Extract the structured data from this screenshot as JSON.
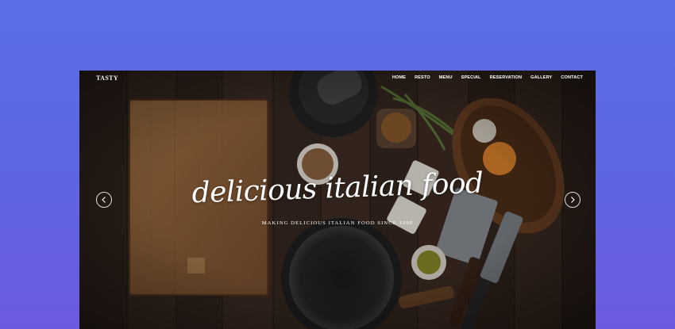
{
  "brand": "TASTY",
  "nav": {
    "items": [
      "HOME",
      "RESTO",
      "MENU",
      "SPECIAL",
      "RESERVATION",
      "GALLERY",
      "CONTACT"
    ]
  },
  "hero": {
    "title": "delicious italian food",
    "subtitle": "MAKING DELICIOUS ITALIAN FOOD SINCE 1990"
  },
  "colors": {
    "page_background": "#5a6fe6",
    "wood_dark": "#2b211c",
    "cutting_board": "#9a6a3f",
    "text": "#ffffff"
  },
  "icons": {
    "prev": "chevron-left-icon",
    "next": "chevron-right-icon"
  }
}
